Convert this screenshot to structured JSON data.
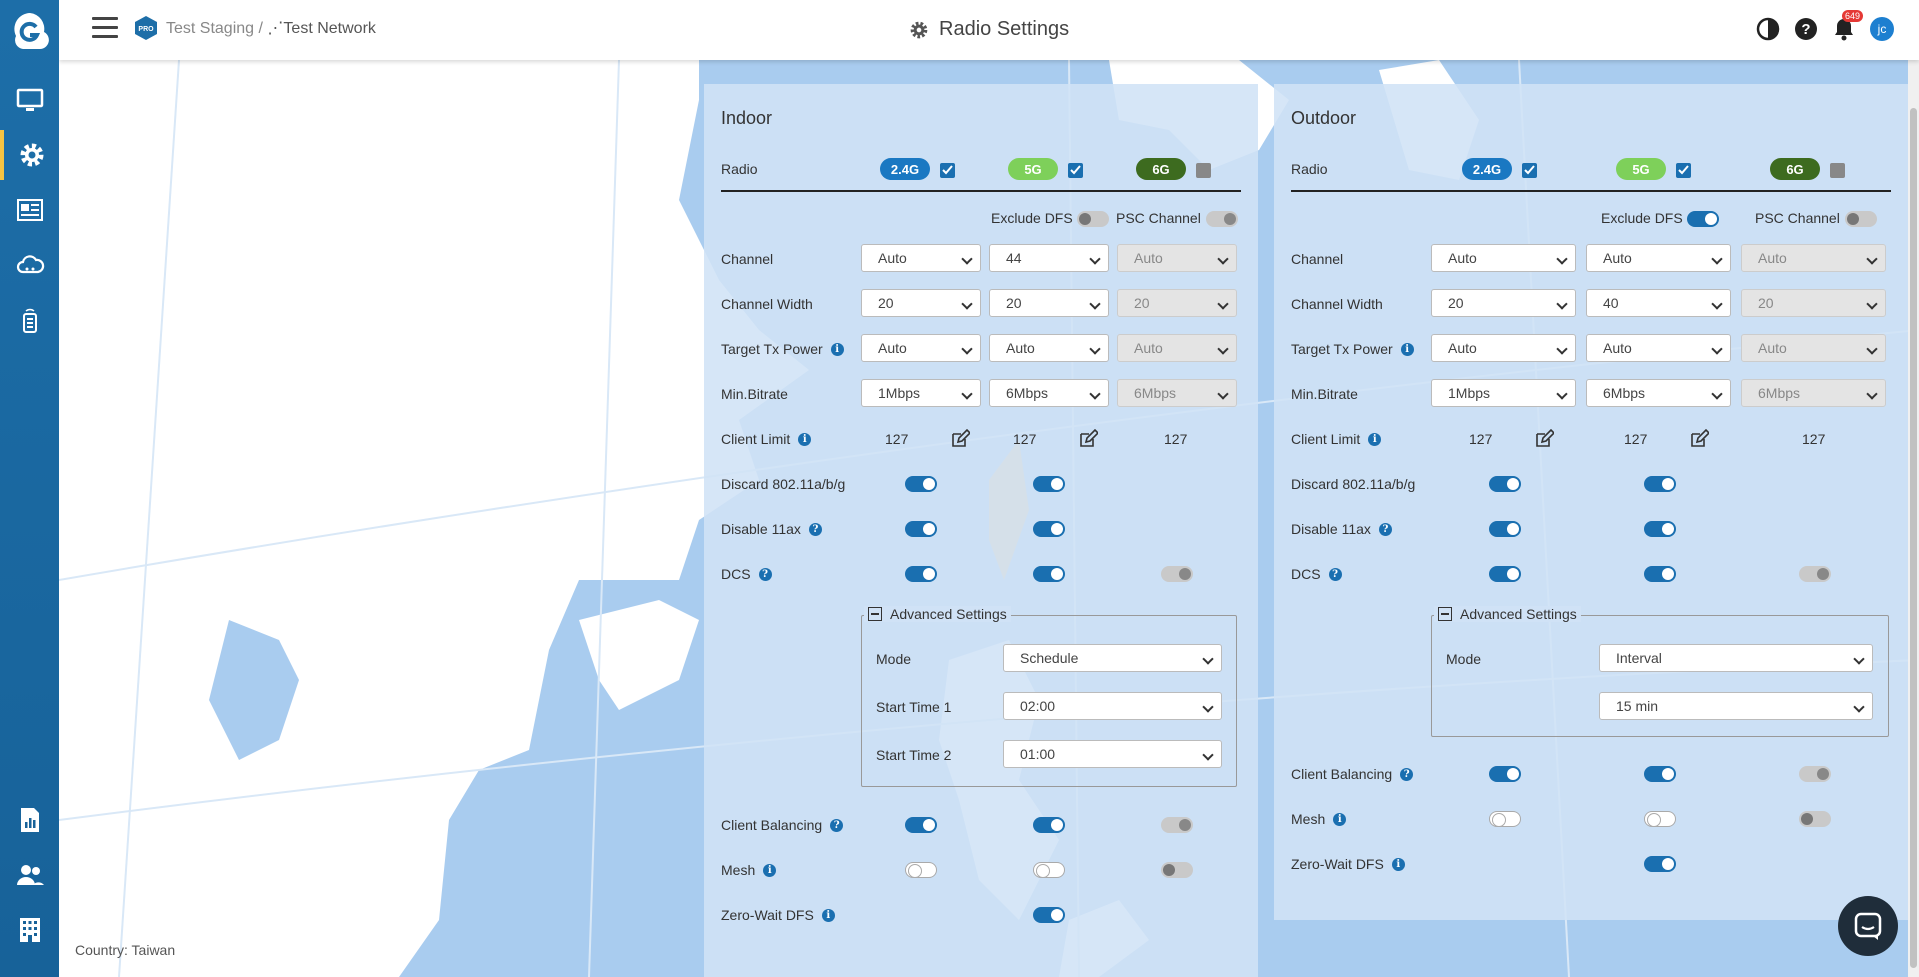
{
  "header": {
    "breadcrumb_org": "Test Staging",
    "breadcrumb_sep": "/",
    "breadcrumb_network": "Test Network",
    "page_title": "Radio Settings",
    "notification_count": "649",
    "avatar_initials": "jc",
    "pro_badge": "PRO"
  },
  "sidebar": {
    "items": [
      {
        "name": "monitor-icon"
      },
      {
        "name": "gear-icon",
        "active": true
      },
      {
        "name": "report-icon"
      },
      {
        "name": "cloud-icon"
      },
      {
        "name": "device-icon"
      },
      {
        "name": "chart-icon"
      },
      {
        "name": "users-icon"
      },
      {
        "name": "building-icon"
      }
    ]
  },
  "map": {
    "country_label": "Country: Taiwan"
  },
  "indoor": {
    "title": "Indoor",
    "radio_label": "Radio",
    "bands": [
      {
        "label": "2.4G",
        "checked": true
      },
      {
        "label": "5G",
        "checked": true
      },
      {
        "label": "6G",
        "checked": false
      }
    ],
    "exclude_dfs_label": "Exclude DFS",
    "exclude_dfs": false,
    "psc_channel_label": "PSC Channel",
    "psc_channel": false,
    "rows": {
      "channel": {
        "label": "Channel",
        "values": [
          "Auto",
          "44",
          "Auto"
        ]
      },
      "channel_width": {
        "label": "Channel Width",
        "values": [
          "20",
          "20",
          "20"
        ]
      },
      "target_tx_power": {
        "label": "Target Tx Power",
        "values": [
          "Auto",
          "Auto",
          "Auto"
        ]
      },
      "min_bitrate": {
        "label": "Min.Bitrate",
        "values": [
          "1Mbps",
          "6Mbps",
          "6Mbps"
        ]
      },
      "client_limit": {
        "label": "Client Limit",
        "values": [
          "127",
          "127",
          "127"
        ]
      },
      "discard": {
        "label": "Discard 802.11a/b/g"
      },
      "disable_11ax": {
        "label": "Disable 11ax"
      },
      "dcs": {
        "label": "DCS"
      },
      "client_balancing": {
        "label": "Client Balancing"
      },
      "mesh": {
        "label": "Mesh"
      },
      "zero_wait_dfs": {
        "label": "Zero-Wait DFS"
      }
    },
    "advanced": {
      "legend": "Advanced Settings",
      "mode_label": "Mode",
      "mode_value": "Schedule",
      "start1_label": "Start Time 1",
      "start1_value": "02:00",
      "start2_label": "Start Time 2",
      "start2_value": "01:00"
    }
  },
  "outdoor": {
    "title": "Outdoor",
    "radio_label": "Radio",
    "bands": [
      {
        "label": "2.4G",
        "checked": true
      },
      {
        "label": "5G",
        "checked": true
      },
      {
        "label": "6G",
        "checked": false
      }
    ],
    "exclude_dfs_label": "Exclude DFS",
    "exclude_dfs": true,
    "psc_channel_label": "PSC Channel",
    "psc_channel": false,
    "rows": {
      "channel": {
        "label": "Channel",
        "values": [
          "Auto",
          "Auto",
          "Auto"
        ]
      },
      "channel_width": {
        "label": "Channel Width",
        "values": [
          "20",
          "40",
          "20"
        ]
      },
      "target_tx_power": {
        "label": "Target Tx Power",
        "values": [
          "Auto",
          "Auto",
          "Auto"
        ]
      },
      "min_bitrate": {
        "label": "Min.Bitrate",
        "values": [
          "1Mbps",
          "6Mbps",
          "6Mbps"
        ]
      },
      "client_limit": {
        "label": "Client Limit",
        "values": [
          "127",
          "127",
          "127"
        ]
      },
      "discard": {
        "label": "Discard 802.11a/b/g"
      },
      "disable_11ax": {
        "label": "Disable 11ax"
      },
      "dcs": {
        "label": "DCS"
      },
      "client_balancing": {
        "label": "Client Balancing"
      },
      "mesh": {
        "label": "Mesh"
      },
      "zero_wait_dfs": {
        "label": "Zero-Wait DFS"
      }
    },
    "advanced": {
      "legend": "Advanced Settings",
      "mode_label": "Mode",
      "mode_value": "Interval",
      "interval_value": "15 min"
    }
  },
  "colors": {
    "accent": "#1a6fb0",
    "band_24": "#1a78c2",
    "band_5": "#7ed05a",
    "band_6": "#3d6b1f",
    "sidebar": "#176299",
    "active_marker": "#f5c342"
  }
}
